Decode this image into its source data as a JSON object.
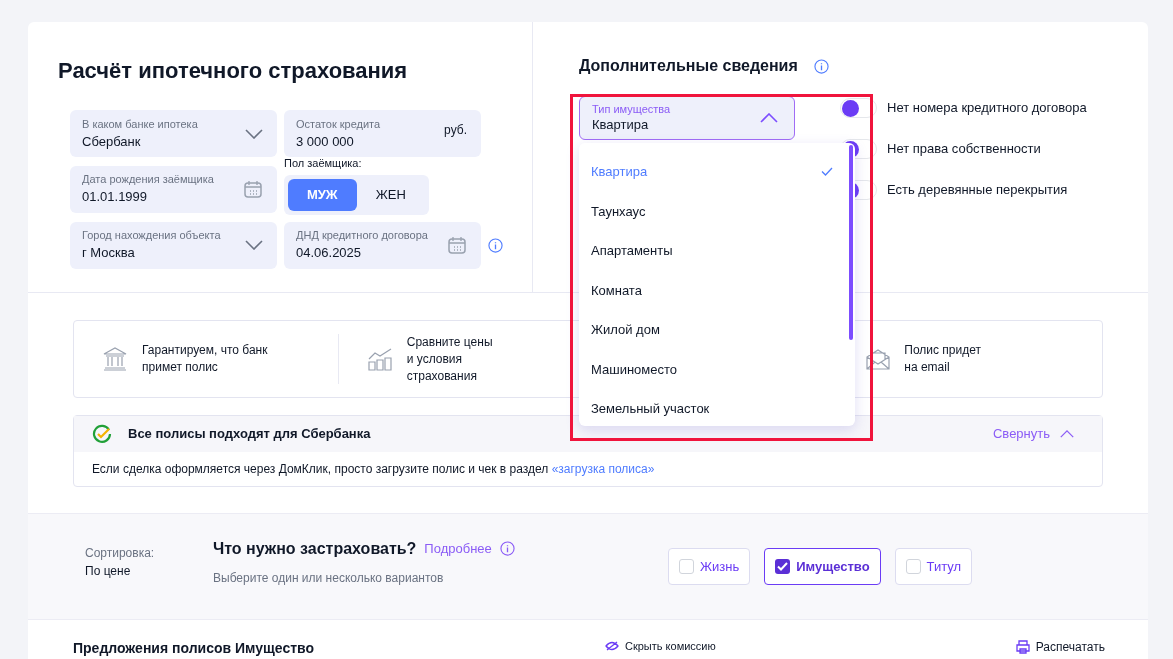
{
  "calculator": {
    "title": "Расчёт ипотечного страхования",
    "fields": [
      {
        "kind": "select",
        "label": "В каком банке ипотека",
        "value": "Сбербанк"
      },
      {
        "kind": "amount",
        "label": "Остаток кредита",
        "value": "3 000 000",
        "unit": "руб."
      },
      {
        "kind": "date",
        "label": "Дата рождения заёмщика",
        "value": "01.01.1999"
      },
      {
        "kind": "gender",
        "label": "Пол заёмщика:",
        "options": [
          {
            "label": "МУЖ",
            "selected": true
          },
          {
            "label": "ЖЕН",
            "selected": false
          }
        ]
      },
      {
        "kind": "select",
        "label": "Город нахождения объекта",
        "value": "г Москва"
      },
      {
        "kind": "date",
        "label": "ДНД кредитного договора",
        "value": "04.06.2025",
        "info": true
      }
    ]
  },
  "additional": {
    "title": "Дополнительные сведения",
    "property_select": {
      "label": "Тип имущества",
      "value": "Квартира",
      "expanded": true,
      "options": [
        {
          "label": "Квартира",
          "selected": true
        },
        {
          "label": "Таунхаус",
          "selected": false
        },
        {
          "label": "Апартаменты",
          "selected": false
        },
        {
          "label": "Комната",
          "selected": false
        },
        {
          "label": "Жилой дом",
          "selected": false
        },
        {
          "label": "Машиноместо",
          "selected": false
        },
        {
          "label": "Земельный участок",
          "selected": false
        }
      ]
    },
    "toggles": [
      {
        "label": "Нет номера кредитного договора",
        "on": false
      },
      {
        "label": "Нет права собственности",
        "on": false
      },
      {
        "label": "Есть деревянные перекрытия",
        "on": false
      }
    ]
  },
  "features": [
    {
      "kind": "bank",
      "text": "Гарантируем, что банк\nпримет полис"
    },
    {
      "kind": "chart",
      "text": "Сравните цены\nи условия\nстрахования"
    },
    {
      "kind": "mail",
      "text": "Полис придет\nна email"
    }
  ],
  "notice": {
    "title": "Все полисы подходят для Сбербанка",
    "collapse": "Свернуть",
    "text": "Если сделка оформляется через ДомКлик, просто загрузите полис и чек в раздел",
    "link": "«загрузка полиса»"
  },
  "filter": {
    "sort_label": "Сортировка:",
    "sort_value": "По цене",
    "question": "Что нужно застраховать?",
    "more": "Подробнее",
    "hint": "Выберите один или несколько вариантов",
    "options": [
      {
        "label": "Жизнь",
        "checked": false
      },
      {
        "label": "Имущество",
        "checked": true
      },
      {
        "label": "Титул",
        "checked": false
      }
    ]
  },
  "offers": {
    "title": "Предложения полисов Имущество",
    "hide_commission": "Скрыть комиссию",
    "print": "Распечатать"
  }
}
